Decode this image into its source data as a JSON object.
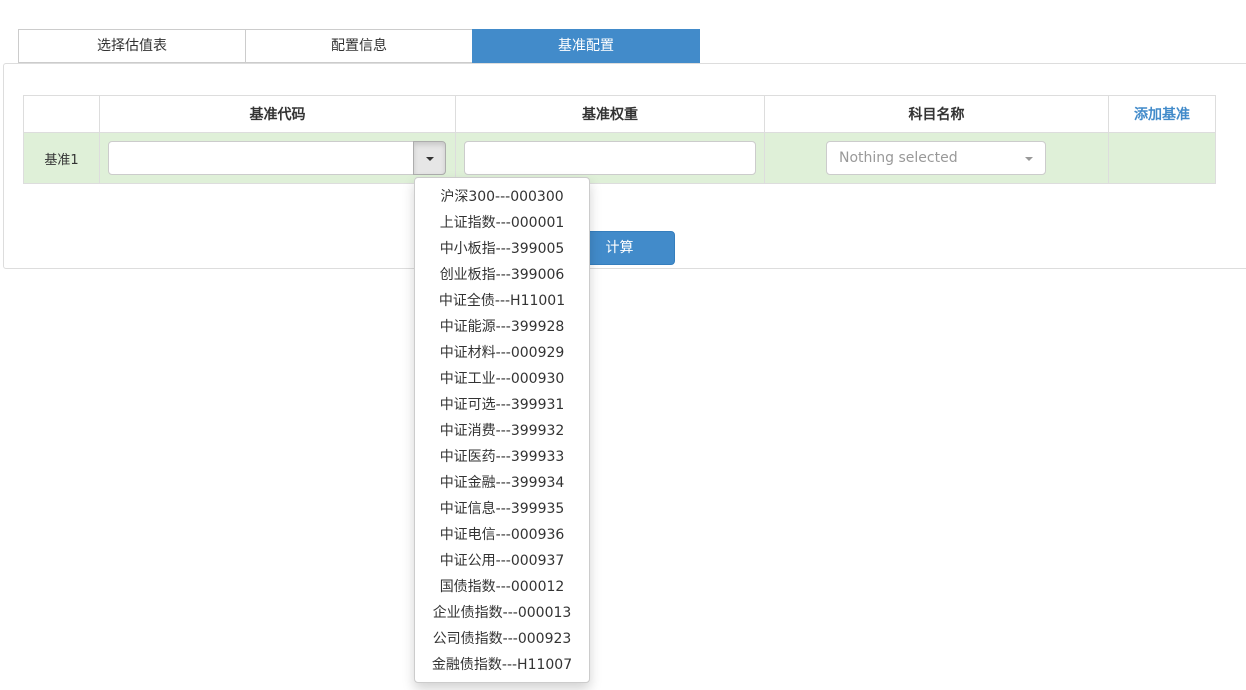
{
  "tabs": [
    {
      "label": "选择估值表",
      "active": false
    },
    {
      "label": "配置信息",
      "active": false
    },
    {
      "label": "基准配置",
      "active": true
    }
  ],
  "table": {
    "headers": [
      "",
      "基准代码",
      "基准权重",
      "科目名称"
    ],
    "add_link": "添加基准",
    "rows": [
      {
        "label": "基准1",
        "code_value": "",
        "weight_value": "",
        "subject_placeholder": "Nothing selected"
      }
    ]
  },
  "calc_button": "计算",
  "dropdown_options": [
    "沪深300---000300",
    "上证指数---000001",
    "中小板指---399005",
    "创业板指---399006",
    "中证全债---H11001",
    "中证能源---399928",
    "中证材料---000929",
    "中证工业---000930",
    "中证可选---399931",
    "中证消费---399932",
    "中证医药---399933",
    "中证金融---399934",
    "中证信息---399935",
    "中证电信---000936",
    "中证公用---000937",
    "国债指数---000012",
    "企业债指数---000013",
    "公司债指数---000923",
    "金融债指数---H11007"
  ],
  "icons": {
    "combo_toggle": "caret-down-icon",
    "select_toggle": "caret-down-icon"
  },
  "colors": {
    "primary": "#428bca",
    "row_success": "#dff0d8",
    "border": "#dddddd"
  }
}
